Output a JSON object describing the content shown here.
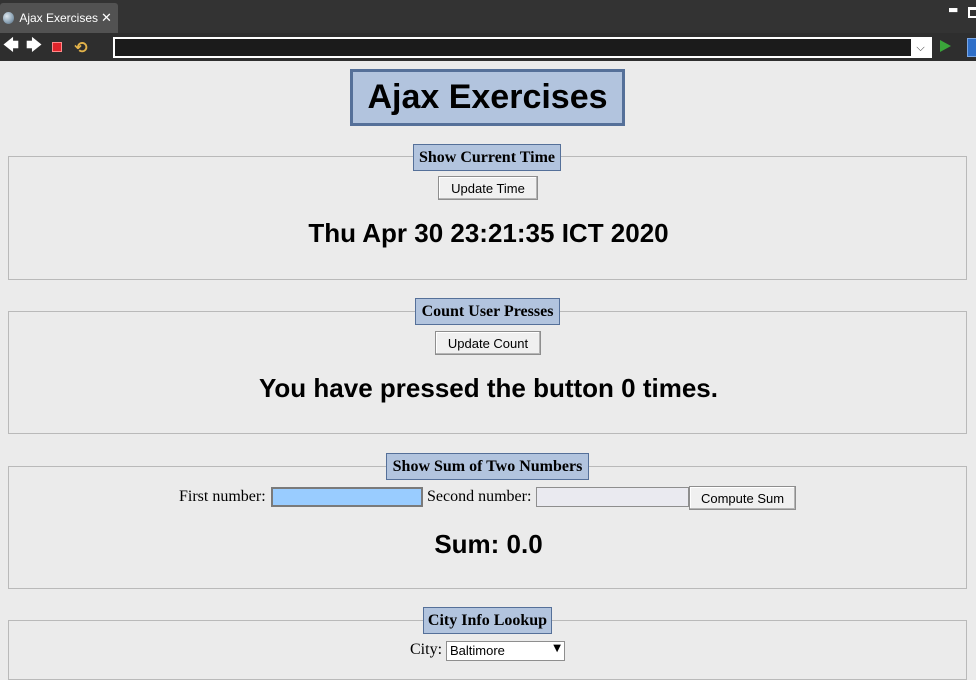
{
  "browser": {
    "tab_title": "Ajax Exercises",
    "tab_close": "✕",
    "nav_back": "🡄",
    "nav_forward": "🡆",
    "refresh_glyph": "⟲",
    "url_value": "",
    "url_dropdown": "⌵"
  },
  "page": {
    "title": "Ajax Exercises",
    "time_section": {
      "legend": "Show Current Time",
      "button_label": "Update Time",
      "current_time": "Thu Apr 30 23:21:35 ICT 2020"
    },
    "count_section": {
      "legend": "Count User Presses",
      "button_label": "Update Count",
      "message": "You have pressed the button 0 times."
    },
    "sum_section": {
      "legend": "Show Sum of Two Numbers",
      "first_label": "First number:",
      "first_value": "",
      "second_label": "Second number:",
      "second_value": "",
      "button_label": "Compute Sum",
      "result": "Sum: 0.0"
    },
    "city_section": {
      "legend": "City Info Lookup",
      "city_label": "City:",
      "city_selected": "Baltimore"
    }
  },
  "colors": {
    "legend_bg": "#b2c4de",
    "legend_border": "#557099",
    "focused_input_bg": "#99ccff",
    "page_bg": "#ebebeb"
  }
}
